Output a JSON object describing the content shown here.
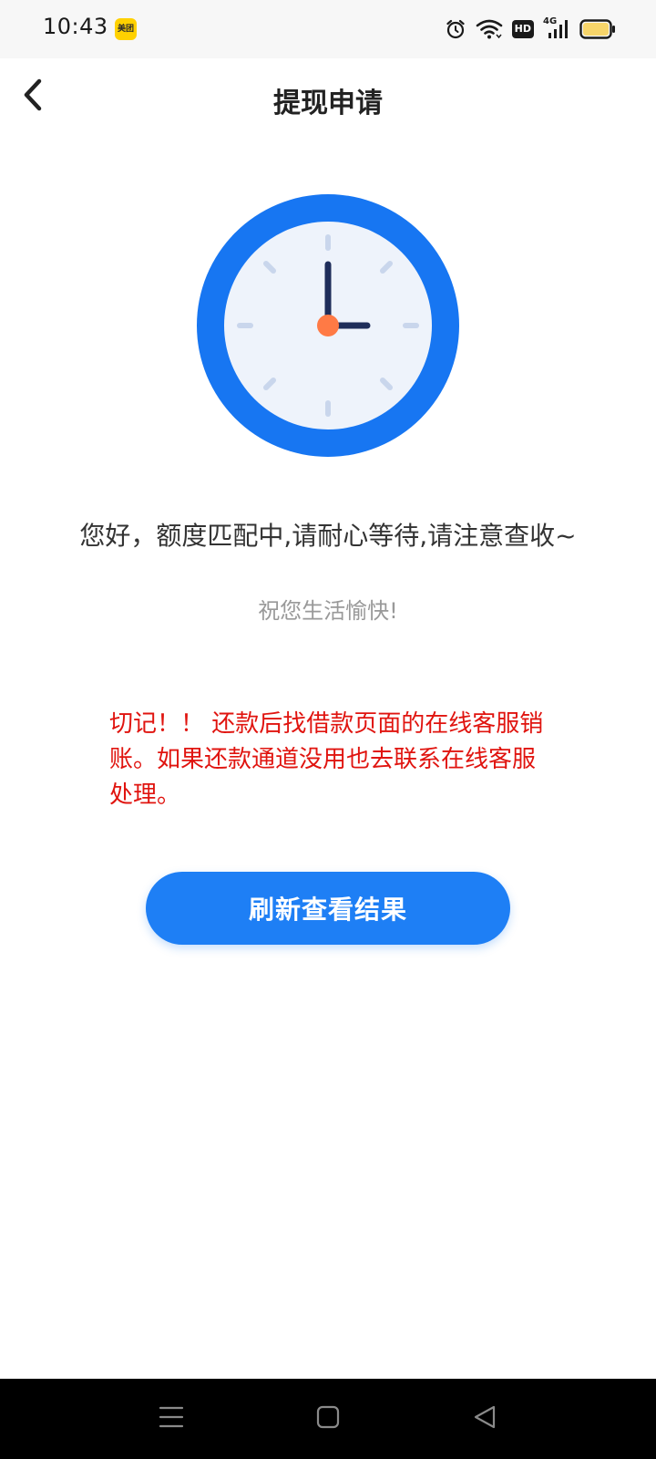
{
  "status_bar": {
    "time": "10:43",
    "app_badge": "美团",
    "network": "4G",
    "hd_label": "HD"
  },
  "header": {
    "title": "提现申请"
  },
  "icons": {
    "back": "chevron-left-icon",
    "clock": "clock-icon",
    "alarm": "alarm-clock-icon",
    "wifi": "wifi-icon",
    "battery": "battery-icon"
  },
  "main": {
    "status_message": "您好，额度匹配中,请耐心等待,请注意查收~",
    "sub_message": "祝您生活愉快!",
    "warning_note": "切记！！ 还款后找借款页面的在线客服销账。如果还款通道没用也去联系在线客服处理。",
    "refresh_label": "刷新查看结果"
  },
  "colors": {
    "accent": "#1e7ff5",
    "warning": "#e0140f",
    "clock_rim": "#1776f2",
    "clock_face": "#eef3fb",
    "clock_hands": "#1e2d5a",
    "clock_center": "#ff7a45",
    "battery_fill": "#f7d56a"
  }
}
